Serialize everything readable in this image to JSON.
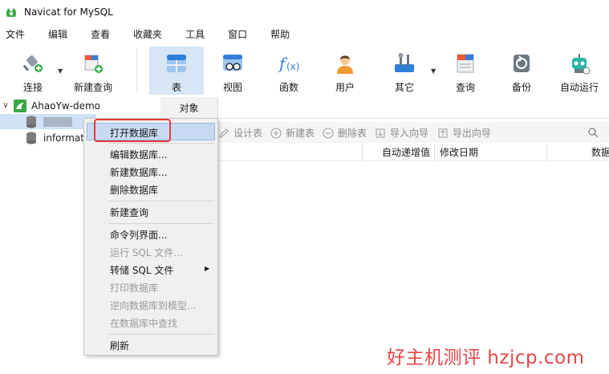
{
  "window": {
    "title": "Navicat for MySQL"
  },
  "menu": [
    "文件",
    "编辑",
    "查看",
    "收藏夹",
    "工具",
    "窗口",
    "帮助"
  ],
  "toolbar": {
    "connect": "连接",
    "new_query": "新建查询",
    "table": "表",
    "view": "视图",
    "function": "函数",
    "user": "用户",
    "other": "其它",
    "query": "查询",
    "backup": "备份",
    "automation": "自动运行"
  },
  "sidebar": {
    "connection": "AhaoYw-demo",
    "db2": "informat"
  },
  "tabs": {
    "objects": "对象"
  },
  "obj_toolbar": {
    "design": "设计表",
    "new": "新建表",
    "delete": "删除表",
    "import": "导入向导",
    "export": "导出向导"
  },
  "columns": {
    "auto_inc": "自动递增值",
    "modified": "修改日期",
    "data": "数据"
  },
  "context_menu": {
    "open_db": "打开数据库",
    "edit_db": "编辑数据库...",
    "new_db": "新建数据库...",
    "delete_db": "删除数据库",
    "new_query": "新建查询",
    "console": "命令列界面...",
    "run_sql": "运行 SQL 文件...",
    "dump_sql": "转储 SQL 文件",
    "print_db": "打印数据库",
    "reverse": "逆向数据库到模型...",
    "find": "在数据库中查找",
    "refresh": "刷新"
  },
  "watermark": "好主机测评 hzjcp.com",
  "colors": {
    "accent": "#d6e6f5",
    "highlight": "#c8daf1",
    "annotation": "#e5393a"
  }
}
